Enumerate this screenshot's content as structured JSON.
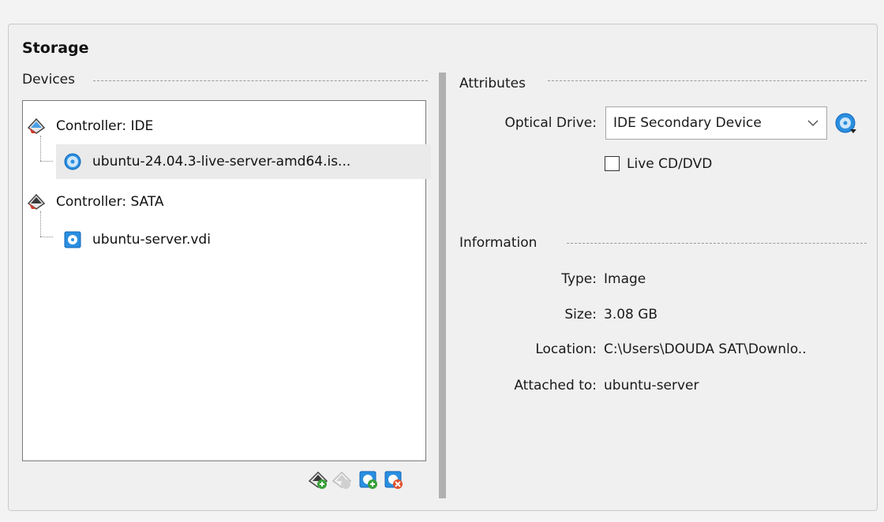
{
  "storage": {
    "title": "Storage",
    "devices_label": "Devices",
    "tree": [
      {
        "label": "Controller: IDE",
        "type": "controller",
        "icon": "ide-controller-icon"
      },
      {
        "label": "ubuntu-24.04.3-live-server-amd64.is...",
        "type": "optical",
        "icon": "optical-disc-icon",
        "selected": true
      },
      {
        "label": "Controller: SATA",
        "type": "controller",
        "icon": "sata-controller-icon"
      },
      {
        "label": "ubuntu-server.vdi",
        "type": "hdd",
        "icon": "hard-disk-icon"
      }
    ],
    "toolbar": [
      "add-controller-icon",
      "remove-controller-icon",
      "add-attachment-icon",
      "remove-attachment-icon"
    ]
  },
  "attributes": {
    "label": "Attributes",
    "optical_drive_label": "Optical Drive:",
    "optical_drive_value": "IDE Secondary Device",
    "live_cd_label": "Live CD/DVD",
    "live_cd_checked": false
  },
  "information": {
    "label": "Information",
    "type_label": "Type:",
    "type_value": "Image",
    "size_label": "Size:",
    "size_value": "3.08 GB",
    "location_label": "Location:",
    "location_value": "C:\\Users\\DOUDA SAT\\Downlo..",
    "attached_label": "Attached to:",
    "attached_value": "ubuntu-server"
  },
  "colors": {
    "accent": "#1e90ff",
    "selection": "#eaeaea"
  }
}
